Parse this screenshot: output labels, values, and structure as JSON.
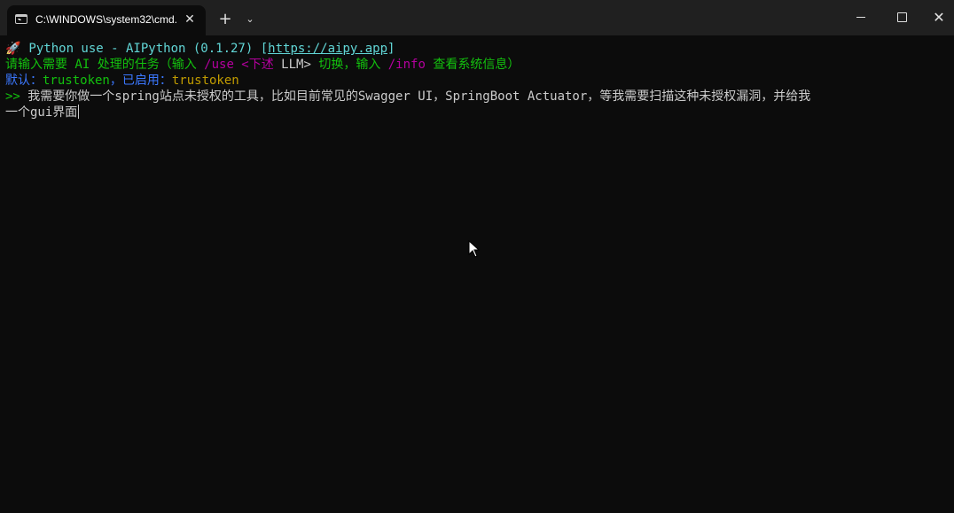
{
  "titlebar": {
    "tab_title": "C:\\WINDOWS\\system32\\cmd.",
    "tab_close": "✕",
    "new_tab": "+",
    "dropdown": "⌄",
    "close_glyph": "✕"
  },
  "terminal": {
    "banner": {
      "rocket": "🚀",
      "text": " Python use - AIPython (0.1.27) [",
      "link": "https://aipy.app",
      "close_bracket": "]"
    },
    "prompt_line": {
      "part1": "请输入需要 AI 处理的任务（输入 ",
      "cmd_use": "/use <下述",
      "llm": " LLM>",
      "part2": " 切换，输入 ",
      "cmd_info": "/info",
      "part3": " 查看系统信息）"
    },
    "default_line": {
      "label": "默认：",
      "default_value": "trustoken",
      "sep": "，已启用：",
      "enabled_value": "trustoken"
    },
    "input": {
      "prompt": ">>",
      "line1": " 我需要你做一个spring站点未授权的工具，比如目前常见的Swagger UI，SpringBoot Actuator，等我需要扫描这种未授权漏洞，并给我",
      "line2": "一个gui界面"
    }
  },
  "colors": {
    "background": "#0c0c0c",
    "titlebar": "#202020",
    "cyan": "#61d6d6",
    "green": "#13c10e",
    "magenta": "#b4009e",
    "yellow": "#c19c00",
    "blue": "#3b78ff",
    "text": "#cccccc"
  }
}
